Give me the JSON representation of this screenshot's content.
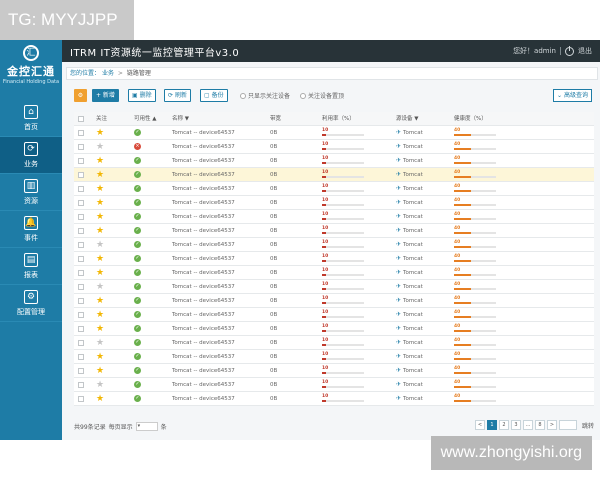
{
  "watermark": {
    "top_left": "TG: MYYJJPP",
    "bottom_right": "www.zhongyishi.org"
  },
  "brand": {
    "logo_char": "汇",
    "name": "金控汇通",
    "subtitle": "Financial Holding Data",
    "color": "#1e7ca6"
  },
  "app": {
    "title": "ITRM IT资源统一监控管理平台v3.0"
  },
  "user": {
    "greeting": "您好！admin",
    "logout_label": "退出"
  },
  "sidebar": {
    "items": [
      {
        "label": "首页",
        "icon": "home-icon",
        "glyph": "⌂"
      },
      {
        "label": "业务",
        "icon": "refresh-cycle-icon",
        "glyph": "⟳",
        "active": true
      },
      {
        "label": "资源",
        "icon": "chart-icon",
        "glyph": "▥"
      },
      {
        "label": "事件",
        "icon": "bell-icon",
        "glyph": "🔔"
      },
      {
        "label": "报表",
        "icon": "report-icon",
        "glyph": "▤"
      },
      {
        "label": "配置管理",
        "icon": "gear-icon",
        "glyph": "⚙"
      }
    ]
  },
  "breadcrumb": {
    "location": "您的位置：",
    "level1": "业务",
    "level2": "链路管理"
  },
  "toolbar": {
    "add": "+ 新增",
    "delete": "删除",
    "refresh": "刷新",
    "backup": "备份",
    "only_followed": "只显示关注设备",
    "follow_top": "关注设备置顶",
    "advanced": "高级查询"
  },
  "columns": {
    "follow": "关注",
    "availability": "可用性 ▲",
    "name": "名称 ▼",
    "arch": "带宽",
    "util": "利用率（%）",
    "source": "源设备 ▼",
    "health": "健康度（%）"
  },
  "rows": [
    {
      "fav": true,
      "status": "ok",
      "name": "Tomcat -- device64537",
      "arch": "0B",
      "util": 10,
      "source": "Tomcat",
      "health": 40
    },
    {
      "fav": false,
      "status": "err",
      "name": "Tomcat -- device64537",
      "arch": "0B",
      "util": 10,
      "source": "Tomcat",
      "health": 40
    },
    {
      "fav": true,
      "status": "ok",
      "name": "Tomcat -- device64537",
      "arch": "0B",
      "util": 10,
      "source": "Tomcat",
      "health": 40
    },
    {
      "fav": true,
      "status": "ok",
      "name": "Tomcat -- device64537",
      "arch": "0B",
      "util": 10,
      "source": "Tomcat",
      "health": 40,
      "highlight": true
    },
    {
      "fav": true,
      "status": "ok",
      "name": "Tomcat -- device64537",
      "arch": "0B",
      "util": 10,
      "source": "Tomcat",
      "health": 40
    },
    {
      "fav": true,
      "status": "ok",
      "name": "Tomcat -- device64537",
      "arch": "0B",
      "util": 10,
      "source": "Tomcat",
      "health": 40
    },
    {
      "fav": true,
      "status": "ok",
      "name": "Tomcat -- device64537",
      "arch": "0B",
      "util": 10,
      "source": "Tomcat",
      "health": 40
    },
    {
      "fav": true,
      "status": "ok",
      "name": "Tomcat -- device64537",
      "arch": "0B",
      "util": 10,
      "source": "Tomcat",
      "health": 40
    },
    {
      "fav": false,
      "status": "ok",
      "name": "Tomcat -- device64537",
      "arch": "0B",
      "util": 10,
      "source": "Tomcat",
      "health": 40
    },
    {
      "fav": true,
      "status": "ok",
      "name": "Tomcat -- device64537",
      "arch": "0B",
      "util": 10,
      "source": "Tomcat",
      "health": 40
    },
    {
      "fav": true,
      "status": "ok",
      "name": "Tomcat -- device64537",
      "arch": "0B",
      "util": 10,
      "source": "Tomcat",
      "health": 40
    },
    {
      "fav": false,
      "status": "ok",
      "name": "Tomcat -- device64537",
      "arch": "0B",
      "util": 10,
      "source": "Tomcat",
      "health": 40
    },
    {
      "fav": true,
      "status": "ok",
      "name": "Tomcat -- device64537",
      "arch": "0B",
      "util": 10,
      "source": "Tomcat",
      "health": 40
    },
    {
      "fav": true,
      "status": "ok",
      "name": "Tomcat -- device64537",
      "arch": "0B",
      "util": 10,
      "source": "Tomcat",
      "health": 40
    },
    {
      "fav": true,
      "status": "ok",
      "name": "Tomcat -- device64537",
      "arch": "0B",
      "util": 10,
      "source": "Tomcat",
      "health": 40
    },
    {
      "fav": false,
      "status": "ok",
      "name": "Tomcat -- device64537",
      "arch": "0B",
      "util": 10,
      "source": "Tomcat",
      "health": 40
    },
    {
      "fav": true,
      "status": "ok",
      "name": "Tomcat -- device64537",
      "arch": "0B",
      "util": 10,
      "source": "Tomcat",
      "health": 40
    },
    {
      "fav": true,
      "status": "ok",
      "name": "Tomcat -- device64537",
      "arch": "0B",
      "util": 10,
      "source": "Tomcat",
      "health": 40
    },
    {
      "fav": false,
      "status": "ok",
      "name": "Tomcat -- device64537",
      "arch": "0B",
      "util": 10,
      "source": "Tomcat",
      "health": 40
    },
    {
      "fav": true,
      "status": "ok",
      "name": "Tomcat -- device64537",
      "arch": "0B",
      "util": 10,
      "source": "Tomcat",
      "health": 40
    }
  ],
  "colors": {
    "util_bar": "#c0392b",
    "health_bar": "#e67e22"
  },
  "footer": {
    "total": "共99条记录",
    "per_page_label": "每页显示",
    "per_page_value": "",
    "per_page_unit": "条",
    "pages": [
      "<",
      "1",
      "2",
      "3",
      "…",
      "8",
      ">"
    ],
    "active_page": "1",
    "goto_label": "跳转"
  }
}
